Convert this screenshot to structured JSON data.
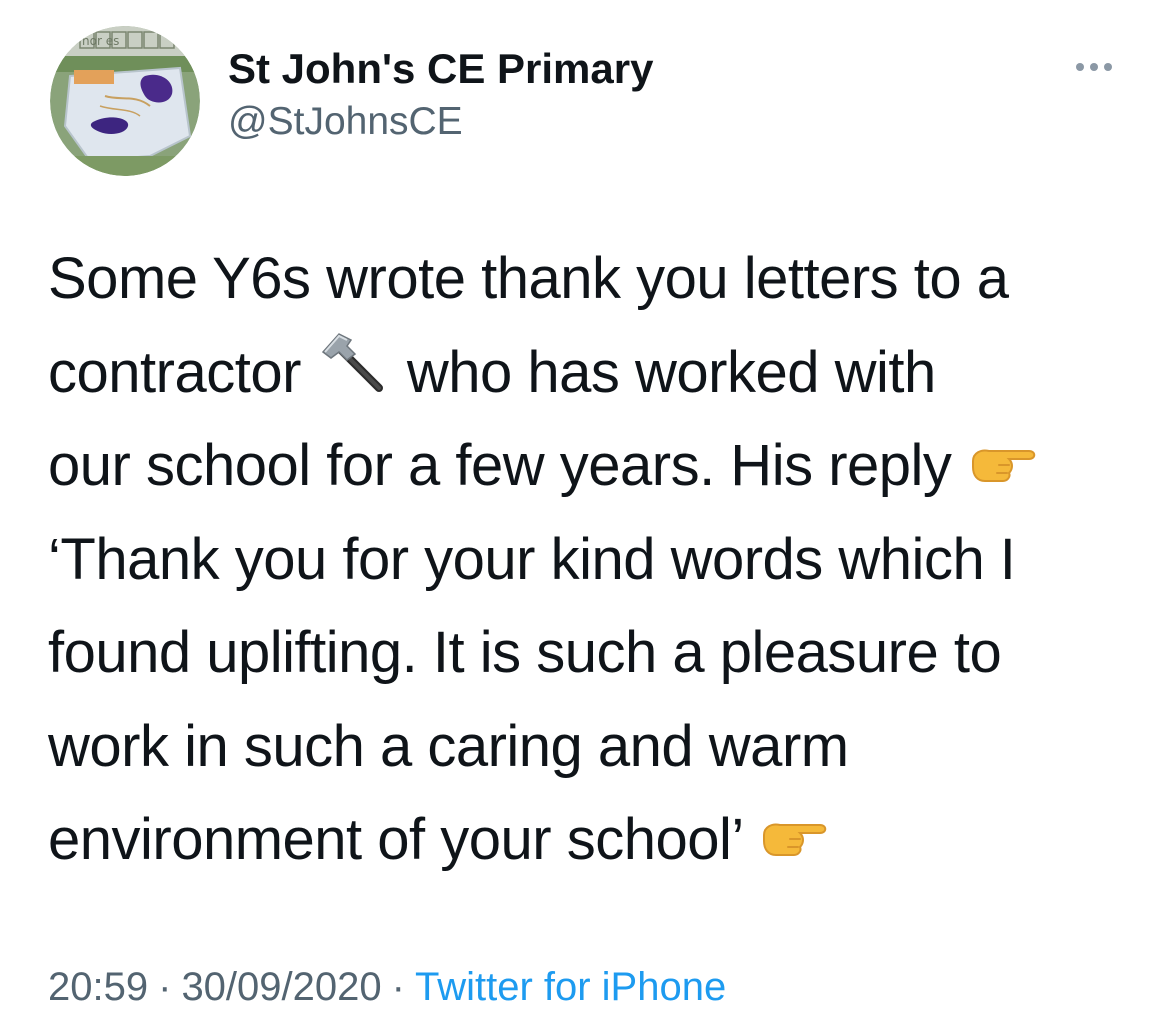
{
  "author": {
    "name": "St John's CE Primary",
    "handle": "@StJohnsCE",
    "avatar_icon": "school-badge-avatar",
    "avatar_sign": "nor es"
  },
  "more_icon": "more-horizontal-icon",
  "tweet": {
    "lines": [
      "Some Y6s wrote thank you letters to a",
      "contractor",
      "who has worked with",
      "our school for a few years. His reply",
      "‘Thank you for your kind words which I",
      "found uplifting.  It is such a pleasure to",
      "work in such a caring and warm",
      "environment of your school’"
    ],
    "emojis": {
      "hammer": "hammer-icon",
      "pointing_right_1": "pointing-right-hand-icon",
      "pointing_right_2": "pointing-right-hand-icon"
    }
  },
  "meta": {
    "time": "20:59",
    "separator": "·",
    "date": "30/09/2020",
    "source": "Twitter for iPhone"
  },
  "colors": {
    "text": "#0f1419",
    "secondary": "#536471",
    "link": "#1d9bf0",
    "emoji_yellow": "#f5b93a"
  }
}
